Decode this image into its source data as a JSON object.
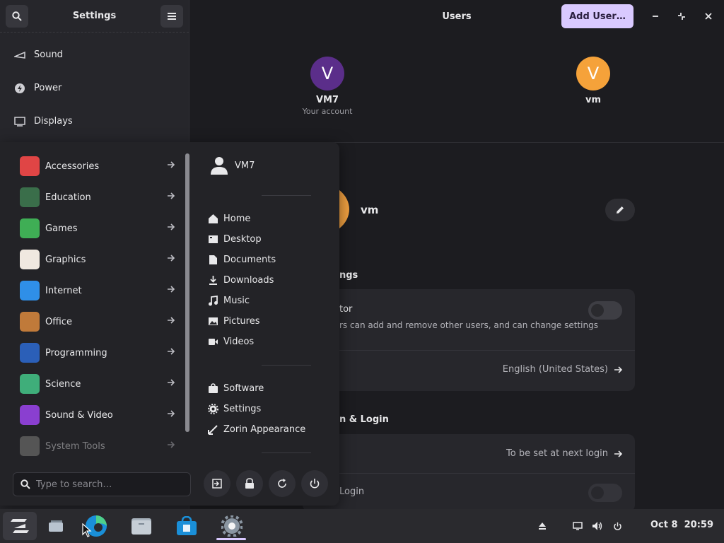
{
  "sidebar": {
    "title": "Settings",
    "items": [
      {
        "label": "Sound",
        "icon": "speaker-icon"
      },
      {
        "label": "Power",
        "icon": "power-bolt-icon"
      },
      {
        "label": "Displays",
        "icon": "display-icon"
      }
    ]
  },
  "main": {
    "title": "Users",
    "add_user_label": "Add User…",
    "users": [
      {
        "initial": "V",
        "name": "VM7",
        "sub": "Your account",
        "color": "#5b2e8a"
      },
      {
        "initial": "V",
        "name": "vm",
        "sub": "",
        "color": "#f5a23a"
      }
    ],
    "selected_user": "vm",
    "account_settings_head": "ngs",
    "admin_title": "tor",
    "admin_sub": "rs can add and remove other users, and can change settings",
    "language_value": "English (United States)",
    "auth_head": "n & Login",
    "password_value": "To be set at next login",
    "autologin_label": "Login"
  },
  "menu": {
    "categories": [
      {
        "label": "Accessories",
        "icon": "accessories-icon",
        "color": "#e04545"
      },
      {
        "label": "Education",
        "icon": "education-icon",
        "color": "#3a6e4a"
      },
      {
        "label": "Games",
        "icon": "gamepad-icon",
        "color": "#3fae55"
      },
      {
        "label": "Graphics",
        "icon": "palette-icon",
        "color": "#f0e8e0"
      },
      {
        "label": "Internet",
        "icon": "cloud-icon",
        "color": "#2f8fe8"
      },
      {
        "label": "Office",
        "icon": "briefcase-icon",
        "color": "#c07a3a"
      },
      {
        "label": "Programming",
        "icon": "programming-icon",
        "color": "#2b5fb8"
      },
      {
        "label": "Science",
        "icon": "flask-icon",
        "color": "#3fae7a"
      },
      {
        "label": "Sound & Video",
        "icon": "music-video-icon",
        "color": "#8a3fd0"
      },
      {
        "label": "System Tools",
        "icon": "monitor-icon",
        "color": "#555"
      }
    ],
    "user": "VM7",
    "places": [
      {
        "label": "Home",
        "icon": "home-icon"
      },
      {
        "label": "Desktop",
        "icon": "desktop-icon"
      },
      {
        "label": "Documents",
        "icon": "document-icon"
      },
      {
        "label": "Downloads",
        "icon": "download-icon"
      },
      {
        "label": "Music",
        "icon": "music-note-icon"
      },
      {
        "label": "Pictures",
        "icon": "picture-icon"
      },
      {
        "label": "Videos",
        "icon": "video-icon"
      }
    ],
    "apps": [
      {
        "label": "Software",
        "icon": "software-bag-icon"
      },
      {
        "label": "Settings",
        "icon": "gear-icon"
      },
      {
        "label": "Zorin Appearance",
        "icon": "appearance-icon"
      }
    ],
    "search_placeholder": "Type to search…"
  },
  "taskbar": {
    "date": "Oct 8",
    "time": "20:59"
  }
}
